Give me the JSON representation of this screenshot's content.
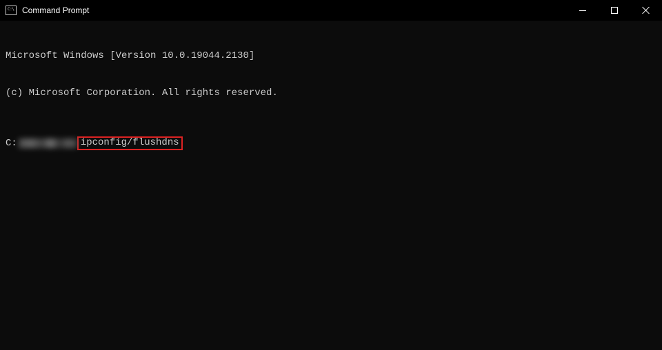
{
  "window": {
    "title": "Command Prompt"
  },
  "terminal": {
    "line1": "Microsoft Windows [Version 10.0.19044.2130]",
    "line2": "(c) Microsoft Corporation. All rights reserved.",
    "prompt_drive": "C:",
    "command": "ipconfig/flushdns"
  },
  "colors": {
    "highlight_border": "#dd2222",
    "terminal_text": "#cccccc",
    "background": "#0c0c0c"
  }
}
